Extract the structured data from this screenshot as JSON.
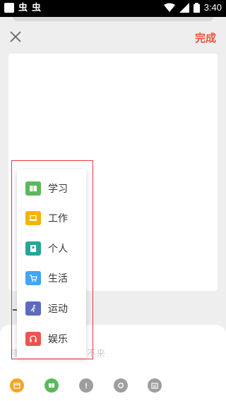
{
  "status_bar": {
    "left_icons": [
      "square-icon",
      "bug-icon",
      "bug-icon"
    ],
    "bug_glyph_1": "虫",
    "bug_glyph_2": "虫",
    "time": "3:40"
  },
  "header": {
    "close_icon": "close-icon",
    "done_label": "完成",
    "done_color": "#f0523d"
  },
  "category_menu": {
    "items": [
      {
        "label": "学习",
        "icon": "book-open-icon",
        "color": "#5cb85c"
      },
      {
        "label": "工作",
        "icon": "laptop-icon",
        "color": "#f4b400"
      },
      {
        "label": "个人",
        "icon": "notebook-icon",
        "color": "#26a69a"
      },
      {
        "label": "生活",
        "icon": "cart-icon",
        "color": "#42a5f5"
      },
      {
        "label": "运动",
        "icon": "run-icon",
        "color": "#5c6bc0"
      },
      {
        "label": "娱乐",
        "icon": "headphones-icon",
        "color": "#ef5350"
      }
    ]
  },
  "bottom": {
    "faint_left": "排",
    "faint_right": "不来",
    "toolbar": [
      {
        "icon": "calendar-icon",
        "color": "#f5a623"
      },
      {
        "icon": "book-open-icon",
        "color": "#5cb85c"
      },
      {
        "icon": "exclamation-icon",
        "color": "#9e9e9e"
      },
      {
        "icon": "repeat-icon",
        "color": "#9e9e9e"
      },
      {
        "icon": "list-calendar-icon",
        "color": "#9e9e9e"
      }
    ]
  }
}
